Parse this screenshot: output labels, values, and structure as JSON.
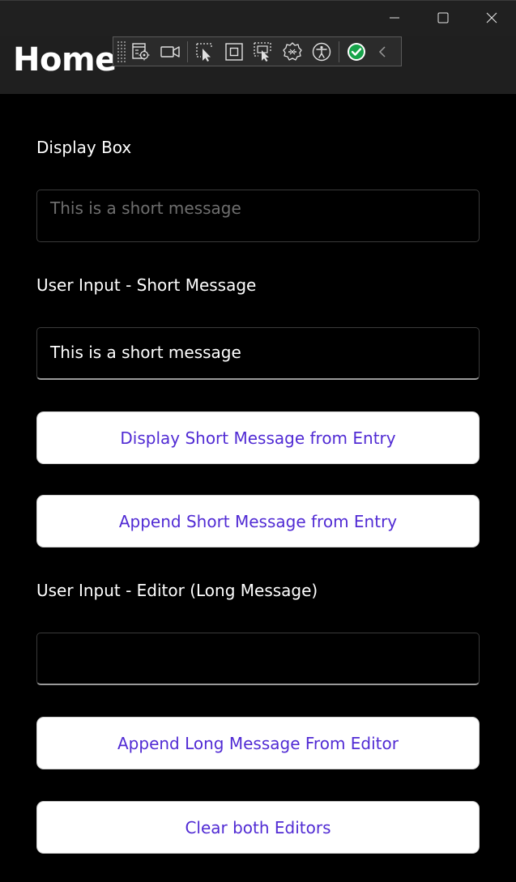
{
  "window": {
    "caption_buttons": [
      "minimize-icon",
      "maximize-icon",
      "close-icon"
    ]
  },
  "header": {
    "title": "Home"
  },
  "debug_toolbar": {
    "icons": [
      "live-visual-tree-icon",
      "record-icon",
      "select-element-icon",
      "display-layout-adorners-icon",
      "track-focus-icon",
      "binding-failures-icon",
      "accessibility-checker-icon",
      "hot-reload-status-icon",
      "collapse-icon"
    ]
  },
  "main": {
    "display_box_label": "Display Box",
    "display_box_value": "This is a short message",
    "short_input_label": "User Input - Short Message",
    "short_input_value": "This is a short message",
    "display_short_button": "Display Short Message from Entry",
    "append_short_button": "Append Short Message from Entry",
    "editor_label": "User Input - Editor (Long Message)",
    "editor_value": "",
    "append_long_button": "Append Long Message From Editor",
    "clear_button": "Clear both Editors"
  },
  "colors": {
    "accent": "#512bd4",
    "background": "#000000",
    "header": "#1f1f1f"
  }
}
